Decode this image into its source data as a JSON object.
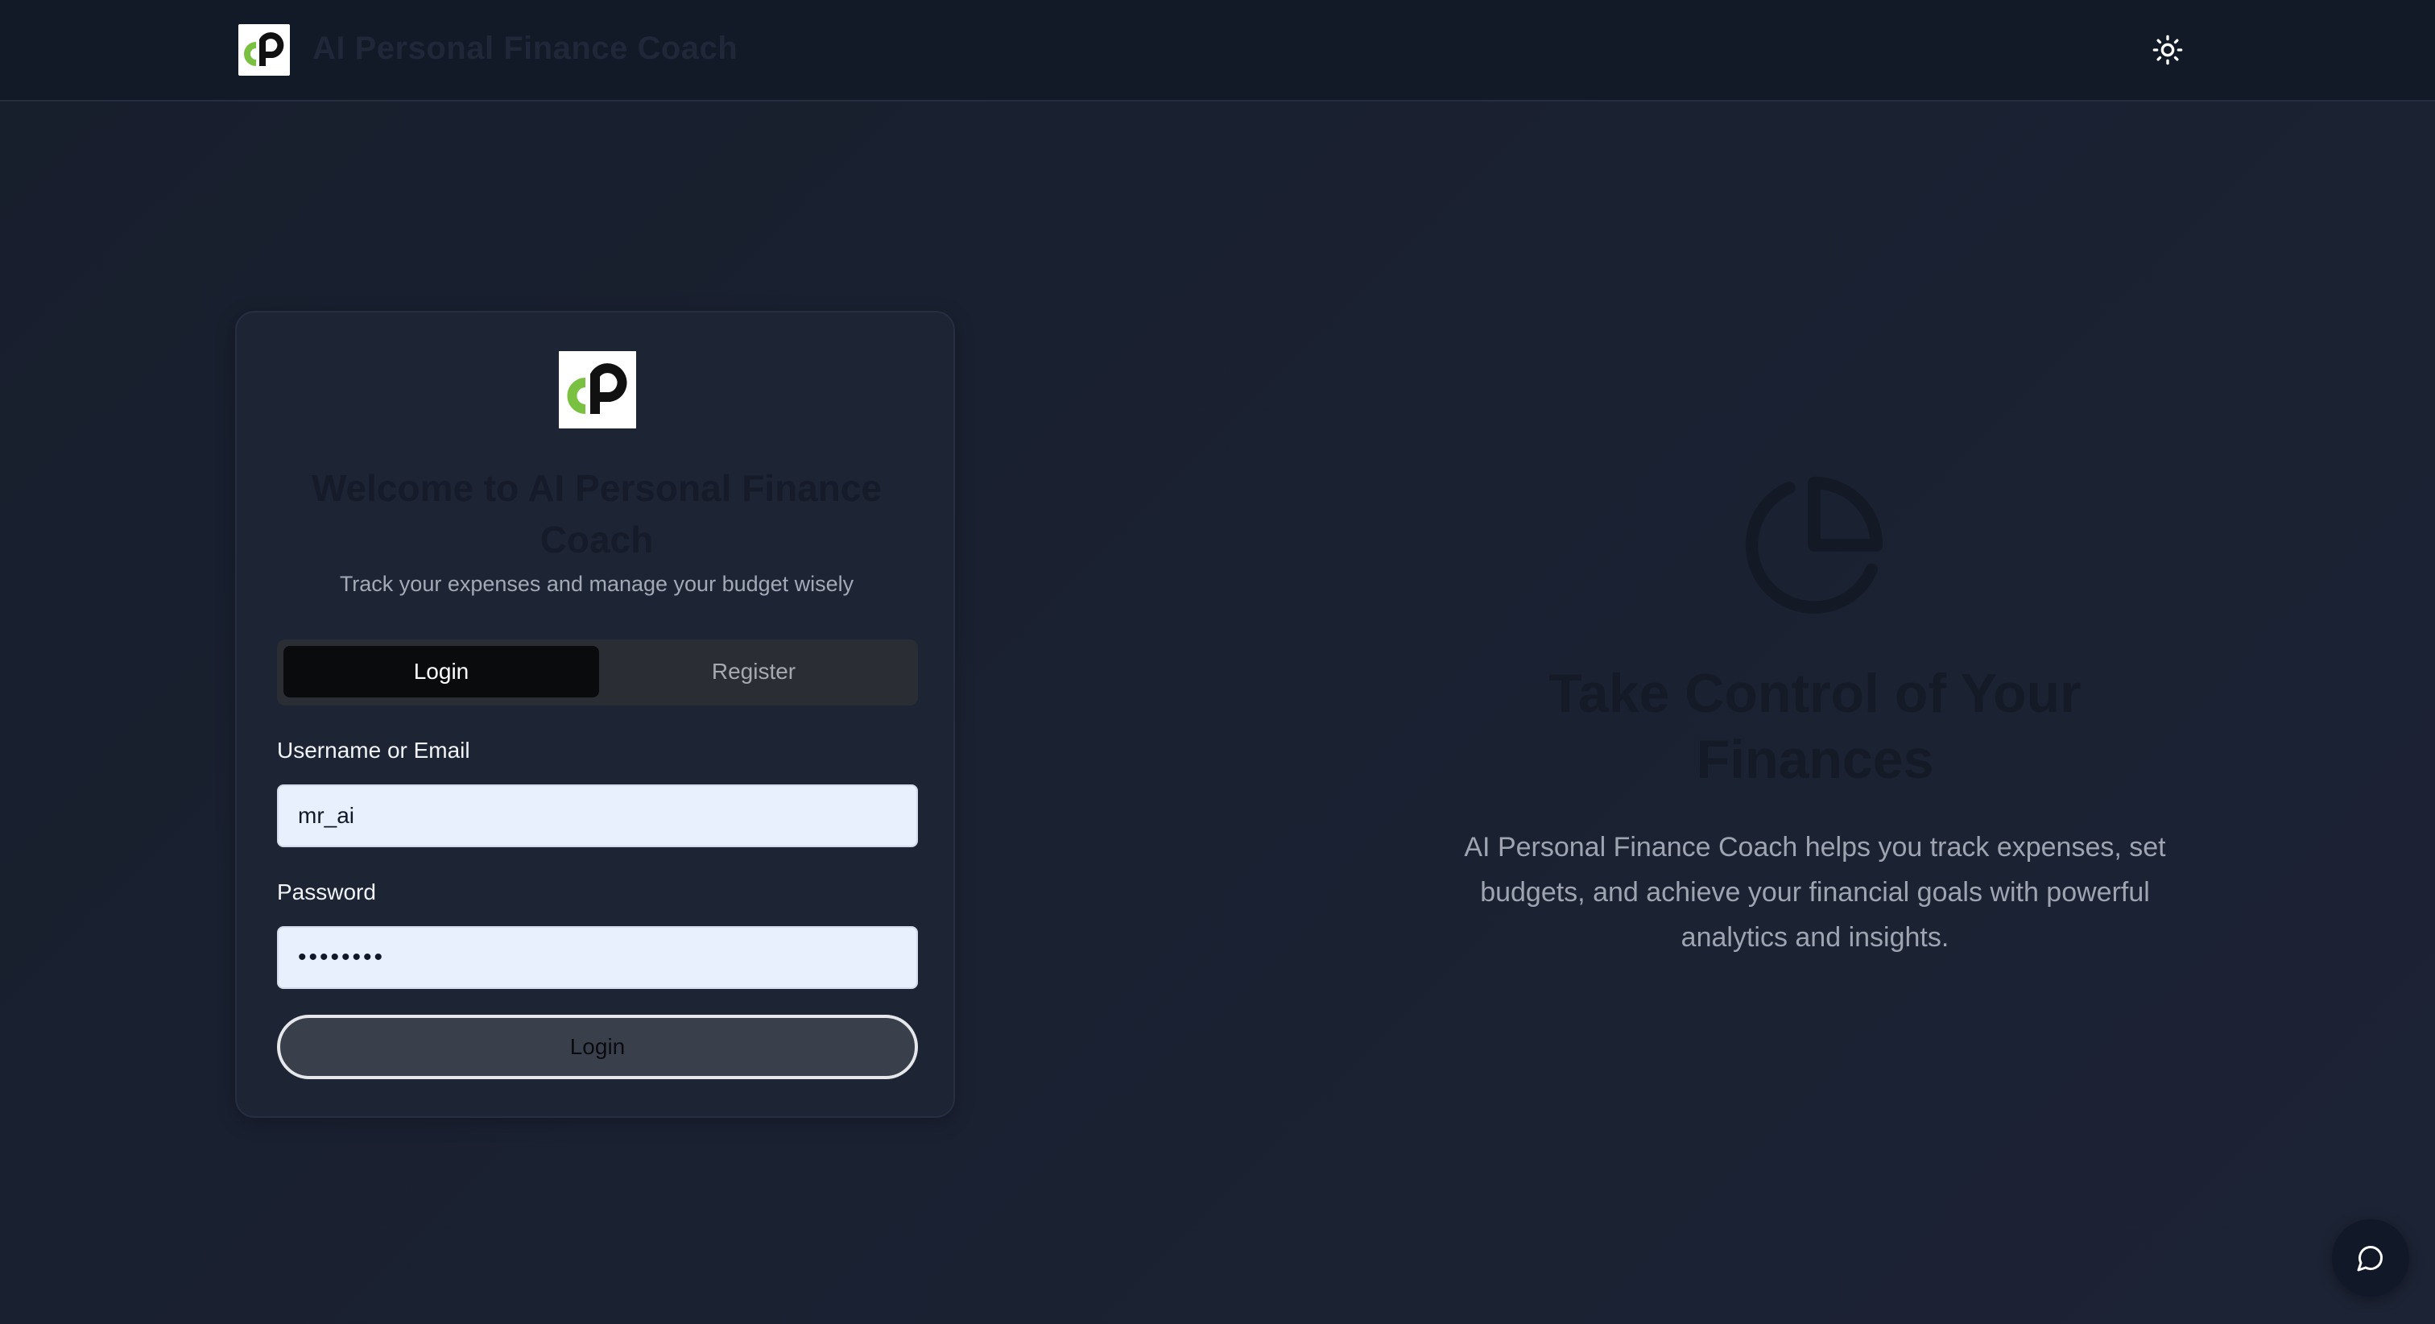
{
  "header": {
    "app_title": "AI Personal Finance Coach",
    "logo_icon": "cp-logo-icon",
    "theme_icon": "sun-icon"
  },
  "auth_card": {
    "title": "Welcome to AI Personal Finance Coach",
    "subtitle": "Track your expenses and manage your budget wisely",
    "tabs": [
      {
        "label": "Login",
        "active": true
      },
      {
        "label": "Register",
        "active": false
      }
    ],
    "username": {
      "label": "Username or Email",
      "value": "mr_ai"
    },
    "password": {
      "label": "Password",
      "value": "••••••••"
    },
    "submit_label": "Login"
  },
  "hero": {
    "icon": "pie-chart-icon",
    "title": "Take Control of Your Finances",
    "description": "AI Personal Finance Coach helps you track expenses, set budgets, and achieve your financial goals with powerful analytics and insights."
  },
  "chat": {
    "icon": "chat-bubble-icon"
  },
  "colors": {
    "background": "#1a2131",
    "header_bg": "#131a27",
    "card_bg": "#1d2434",
    "input_bg": "#e8effd",
    "logo_green": "#7ac142"
  }
}
